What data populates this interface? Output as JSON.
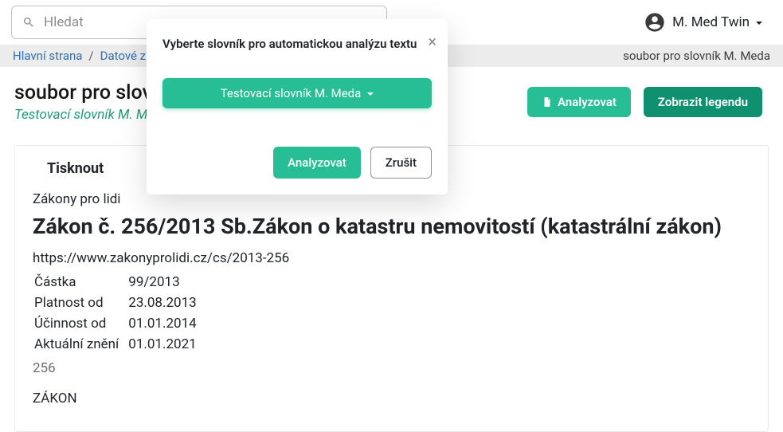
{
  "search": {
    "placeholder": "Hledat"
  },
  "user_name": "M. Med Twin",
  "breadcrumb": {
    "home": "Hlavní strana",
    "section": "Datové z",
    "current": "soubor pro slovník M. Meda"
  },
  "page": {
    "title": "soubor pro slovn",
    "subtitle": "Testovací slovník M. M"
  },
  "buttons": {
    "analyze": "Analyzovat",
    "legend": "Zobrazit legendu"
  },
  "modal": {
    "title": "Vyberte slovník pro automatickou analýzu textu",
    "selected": "Testovací slovník M. Meda",
    "ok": "Analyzovat",
    "cancel": "Zrušit"
  },
  "doc": {
    "print_label": "Tisknout",
    "source": "Zákony pro lidi",
    "law_title": "Zákon č. 256/2013 Sb.Zákon o katastru nemovitostí (katastrální zákon)",
    "url": "https://www.zakonyprolidi.cz/cs/2013-256",
    "meta": [
      {
        "label": "Částka",
        "value": "99/2013"
      },
      {
        "label": "Platnost od",
        "value": "23.08.2013"
      },
      {
        "label": "Účinnost od",
        "value": "01.01.2014"
      },
      {
        "label": "Aktuální znění",
        "value": "01.01.2021"
      }
    ],
    "number": "256",
    "kind": "ZÁKON"
  }
}
